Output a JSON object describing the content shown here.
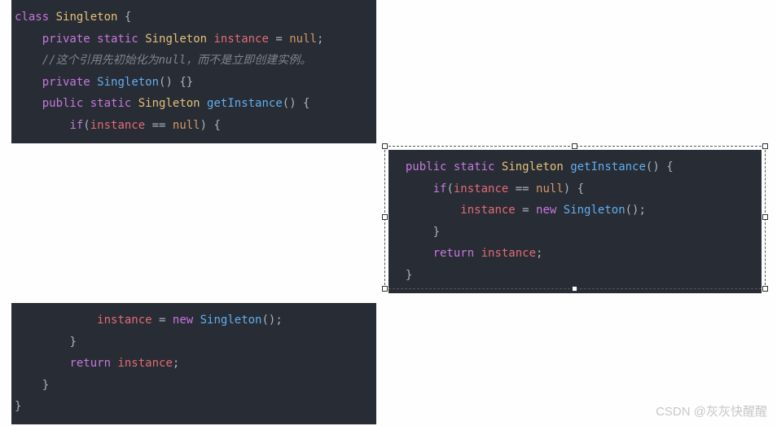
{
  "block1": {
    "l1_class": "class",
    "l1_type": "Singleton",
    "l1_brace": " {",
    "l2_private": "private",
    "l2_static": "static",
    "l2_type": "Singleton",
    "l2_var": "instance",
    "l2_eq": " = ",
    "l2_null": "null",
    "l2_semi": ";",
    "l3_comment": "//这个引用先初始化为null，而不是立即创建实例。",
    "l4_private": "private",
    "l4_type": "Singleton",
    "l4_rest": "() {}",
    "l5_public": "public",
    "l5_static": "static",
    "l5_type": "Singleton",
    "l5_func": "getInstance",
    "l5_rest": "() {",
    "l6_if": "if",
    "l6_open": "(",
    "l6_var": "instance",
    "l6_eqeq": " == ",
    "l6_null": "null",
    "l6_close": ") {"
  },
  "block2": {
    "l1_public": "public",
    "l1_static": "static",
    "l1_type": "Singleton",
    "l1_func": "getInstance",
    "l1_rest": "() {",
    "l2_if": "if",
    "l2_open": "(",
    "l2_var": "instance",
    "l2_eqeq": " == ",
    "l2_null": "null",
    "l2_close": ") {",
    "l3_var": "instance",
    "l3_eq": " = ",
    "l3_new": "new",
    "l3_ctor": "Singleton",
    "l3_rest": "();",
    "l4_brace": "}",
    "l5_return": "return",
    "l5_var": "instance",
    "l5_semi": ";",
    "l6_brace": "}"
  },
  "block3": {
    "l1_var": "instance",
    "l1_eq": " = ",
    "l1_new": "new",
    "l1_ctor": "Singleton",
    "l1_rest": "();",
    "l2_brace": "}",
    "l3_return": "return",
    "l3_var": "instance",
    "l3_semi": ";",
    "l4_brace": "}",
    "l5_brace": "}"
  },
  "watermark": "CSDN @灰灰快醒醒"
}
